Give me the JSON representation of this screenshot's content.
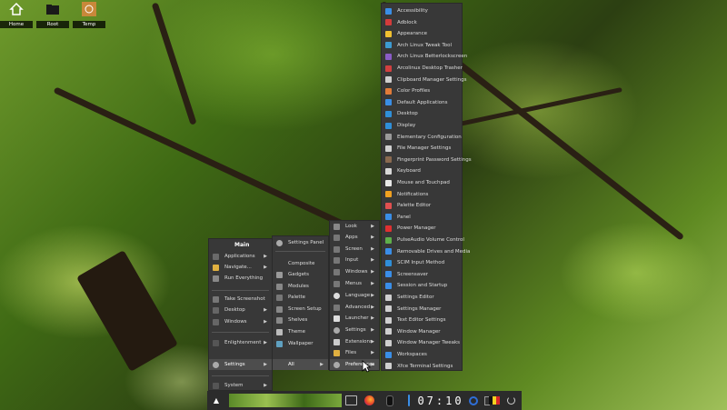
{
  "desktop_icons": [
    {
      "label": "Home"
    },
    {
      "label": "Root"
    },
    {
      "label": "Temp"
    }
  ],
  "main_menu": {
    "title": "Main",
    "items": [
      {
        "label": "Applications",
        "icon": "applications-icon",
        "has_sub": true
      },
      {
        "label": "Navigate...",
        "icon": "folder-icon",
        "has_sub": true
      },
      {
        "label": "Run Everything",
        "icon": "run-icon",
        "has_sub": false
      },
      {
        "label": "Take Screenshot",
        "icon": "screenshot-icon",
        "has_sub": false
      },
      {
        "label": "Desktop",
        "icon": "desktop-icon",
        "has_sub": true
      },
      {
        "label": "Windows",
        "icon": "windows-icon",
        "has_sub": true
      },
      {
        "label": "Enlightenment",
        "icon": "enlightenment-icon",
        "has_sub": true
      },
      {
        "label": "Settings",
        "icon": "settings-icon",
        "has_sub": true
      },
      {
        "label": "System",
        "icon": "system-icon",
        "has_sub": true
      }
    ]
  },
  "settings_menu": {
    "items": [
      {
        "label": "Settings Panel",
        "icon": "settings-panel-icon"
      },
      {
        "label": "Composite",
        "icon": "composite-icon"
      },
      {
        "label": "Gadgets",
        "icon": "gadgets-icon"
      },
      {
        "label": "Modules",
        "icon": "modules-icon"
      },
      {
        "label": "Palette",
        "icon": "palette-icon"
      },
      {
        "label": "Screen Setup",
        "icon": "screen-setup-icon"
      },
      {
        "label": "Shelves",
        "icon": "shelves-icon"
      },
      {
        "label": "Theme",
        "icon": "theme-icon"
      },
      {
        "label": "Wallpaper",
        "icon": "wallpaper-icon"
      },
      {
        "label": "All",
        "icon": "all-icon"
      }
    ]
  },
  "all_menu": {
    "items": [
      {
        "label": "Look",
        "icon": "look-icon"
      },
      {
        "label": "Apps",
        "icon": "apps-icon"
      },
      {
        "label": "Screen",
        "icon": "screen-icon"
      },
      {
        "label": "Input",
        "icon": "input-icon"
      },
      {
        "label": "Windows",
        "icon": "windows-icon"
      },
      {
        "label": "Menus",
        "icon": "menus-icon"
      },
      {
        "label": "Language",
        "icon": "language-icon"
      },
      {
        "label": "Advanced",
        "icon": "advanced-icon"
      },
      {
        "label": "Launcher",
        "icon": "launcher-icon"
      },
      {
        "label": "Settings",
        "icon": "settings-icon"
      },
      {
        "label": "Extensions",
        "icon": "extensions-icon"
      },
      {
        "label": "Files",
        "icon": "files-icon"
      },
      {
        "label": "Preferences",
        "icon": "preferences-icon"
      }
    ]
  },
  "preferences_menu": {
    "items": [
      {
        "label": "Accessibility",
        "color": "#3a8ee6"
      },
      {
        "label": "Adblock",
        "color": "#d23b3b"
      },
      {
        "label": "Appearance",
        "color": "#f0c030"
      },
      {
        "label": "Arch Linux Tweak Tool",
        "color": "#3d9ad1"
      },
      {
        "label": "Arch Linux Betterlockscreen",
        "color": "#8a5cc6"
      },
      {
        "label": "Arcolinux Desktop Trasher",
        "color": "#d24040"
      },
      {
        "label": "Clipboard Manager Settings",
        "color": "#cfcfcf"
      },
      {
        "label": "Color Profiles",
        "color": "#e07b39"
      },
      {
        "label": "Default Applications",
        "color": "#3a8ee6"
      },
      {
        "label": "Desktop",
        "color": "#2f8fd8"
      },
      {
        "label": "Display",
        "color": "#2f8fd8"
      },
      {
        "label": "Elementary Configuration",
        "color": "#9a9a9a"
      },
      {
        "label": "File Manager Settings",
        "color": "#d0d0d0"
      },
      {
        "label": "Fingerprint Password Settings",
        "color": "#8a6a50"
      },
      {
        "label": "Keyboard",
        "color": "#d8d8d8"
      },
      {
        "label": "Mouse and Touchpad",
        "color": "#e8e8e8"
      },
      {
        "label": "Notifications",
        "color": "#f0a020"
      },
      {
        "label": "Palette Editor",
        "color": "#e05050"
      },
      {
        "label": "Panel",
        "color": "#3a8ee6"
      },
      {
        "label": "Power Manager",
        "color": "#e03030"
      },
      {
        "label": "PulseAudio Volume Control",
        "color": "#5fb04a"
      },
      {
        "label": "Removable Drives and Media",
        "color": "#3a8ee6"
      },
      {
        "label": "SCIM Input Method",
        "color": "#2f8fd8"
      },
      {
        "label": "Screensaver",
        "color": "#3a8ee6"
      },
      {
        "label": "Session and Startup",
        "color": "#3a8ee6"
      },
      {
        "label": "Settings Editor",
        "color": "#cfcfcf"
      },
      {
        "label": "Settings Manager",
        "color": "#cfcfcf"
      },
      {
        "label": "Text Editor Settings",
        "color": "#cfcfcf"
      },
      {
        "label": "Window Manager",
        "color": "#cfcfcf"
      },
      {
        "label": "Window Manager Tweaks",
        "color": "#cfcfcf"
      },
      {
        "label": "Workspaces",
        "color": "#3a8ee6"
      },
      {
        "label": "Xfce Terminal Settings",
        "color": "#cfcfcf"
      }
    ]
  },
  "taskbar": {
    "clock": "07:10",
    "apps": [
      "terminal-icon",
      "firefox-icon",
      "mouse-icon"
    ]
  }
}
